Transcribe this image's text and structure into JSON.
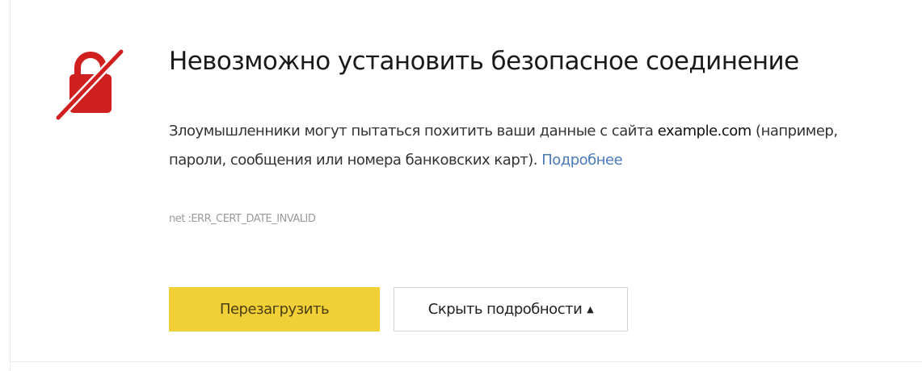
{
  "error_page": {
    "title": "Невозможно установить безопасное соединение",
    "description_prefix": "Злоумышленники могут пытаться похитить ваши данные с сайта ",
    "site": "example.com",
    "description_suffix": " (например, пароли, сообщения или номера банковских карт). ",
    "more_link": "Подробнее",
    "error_code": "net :ERR_CERT_DATE_INVALID",
    "lock_icon": "broken-lock-icon",
    "colors": {
      "accent": "#f1d037",
      "icon": "#d01f1f",
      "link": "#4a7ab8"
    }
  },
  "buttons": {
    "reload_label": "Перезагрузить",
    "details_label": "Скрыть подробности",
    "details_caret": "▲"
  }
}
